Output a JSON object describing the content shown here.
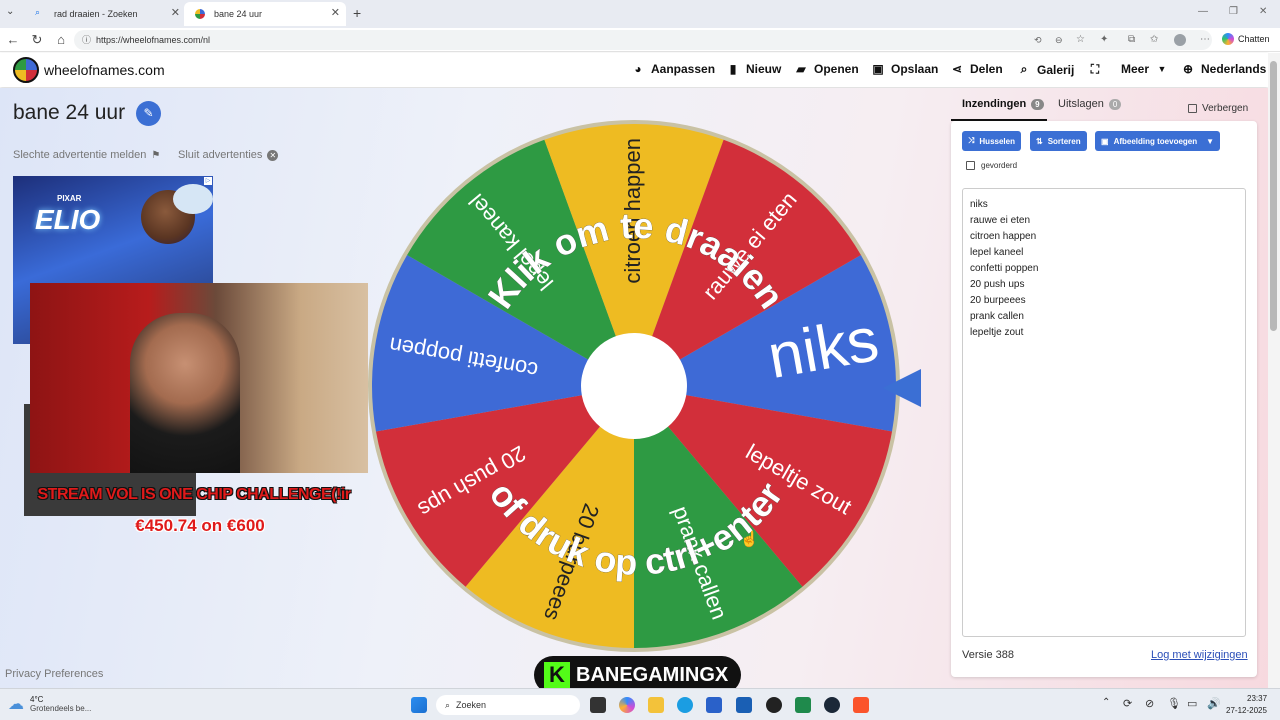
{
  "browser": {
    "tabs": [
      {
        "title": "rad draaien - Zoeken"
      },
      {
        "title": "bane 24 uur"
      }
    ],
    "new_tab": "+",
    "url": "https://wheelofnames.com/nl",
    "chat_button": "Chatten"
  },
  "site": {
    "logo_text": "wheelofnames.com",
    "menu": [
      {
        "label": "Aanpassen",
        "icon": "palette-icon"
      },
      {
        "label": "Nieuw",
        "icon": "file-icon"
      },
      {
        "label": "Openen",
        "icon": "folder-icon"
      },
      {
        "label": "Opslaan",
        "icon": "save-icon"
      },
      {
        "label": "Delen",
        "icon": "share-icon"
      },
      {
        "label": "Galerij",
        "icon": "search-icon"
      },
      {
        "label": "",
        "icon": "fullscreen-icon"
      },
      {
        "label": "Meer",
        "icon": "chevron-down-icon"
      },
      {
        "label": "Nederlands",
        "icon": "globe-icon"
      }
    ]
  },
  "wheel_title": "bane 24 uur",
  "ads": {
    "report": "Slechte advertentie melden",
    "close": "Sluit advertenties",
    "banner_brand": "PIXAR",
    "banner_title": "ELIO"
  },
  "stream_overlay": {
    "title": "STREAM VOL IS ONE CHIP CHALLENGE(!ir",
    "goal": "€450.74 on €600",
    "brand": "BANEGAMINGX"
  },
  "wheel": {
    "center_text_top": "Klik om te draaien",
    "center_text_bottom": "of druk op ctrl+enter",
    "segments": [
      {
        "label": "niks",
        "color": "#3e6ad6"
      },
      {
        "label": "lepeltje zout",
        "color": "#d22f3a"
      },
      {
        "label": "prank callen",
        "color": "#2e9a43"
      },
      {
        "label": "20 burpeees",
        "color": "#eebb22"
      },
      {
        "label": "20 push ups",
        "color": "#d22f3a"
      },
      {
        "label": "confetti poppen",
        "color": "#3e6ad6"
      },
      {
        "label": "lepel kaneel",
        "color": "#2e9a43"
      },
      {
        "label": "citroen happen",
        "color": "#eebb22"
      },
      {
        "label": "rauwe ei eten",
        "color": "#d22f3a"
      }
    ]
  },
  "panel": {
    "tab_entries": "Inzendingen",
    "tab_entries_count": "9",
    "tab_results": "Uitslagen",
    "tab_results_count": "0",
    "hide_label": "Verbergen",
    "shuffle": "Husselen",
    "sort": "Sorteren",
    "add_image": "Afbeelding toevoegen",
    "advanced": "gevorderd",
    "entries": [
      "niks",
      "rauwe ei eten",
      "citroen happen",
      "lepel kaneel",
      "confetti poppen",
      "20 push ups",
      "20 burpeees",
      "prank callen",
      "lepeltje zout"
    ],
    "version": "Versie 388",
    "changelog": "Log met wijzigingen"
  },
  "footer": {
    "privacy": "Privacy Preferences"
  },
  "taskbar": {
    "weather_temp": "4°C",
    "weather_desc": "Grotendeels be...",
    "search": "Zoeken",
    "time": "23:37",
    "date": "27-12-2025"
  }
}
